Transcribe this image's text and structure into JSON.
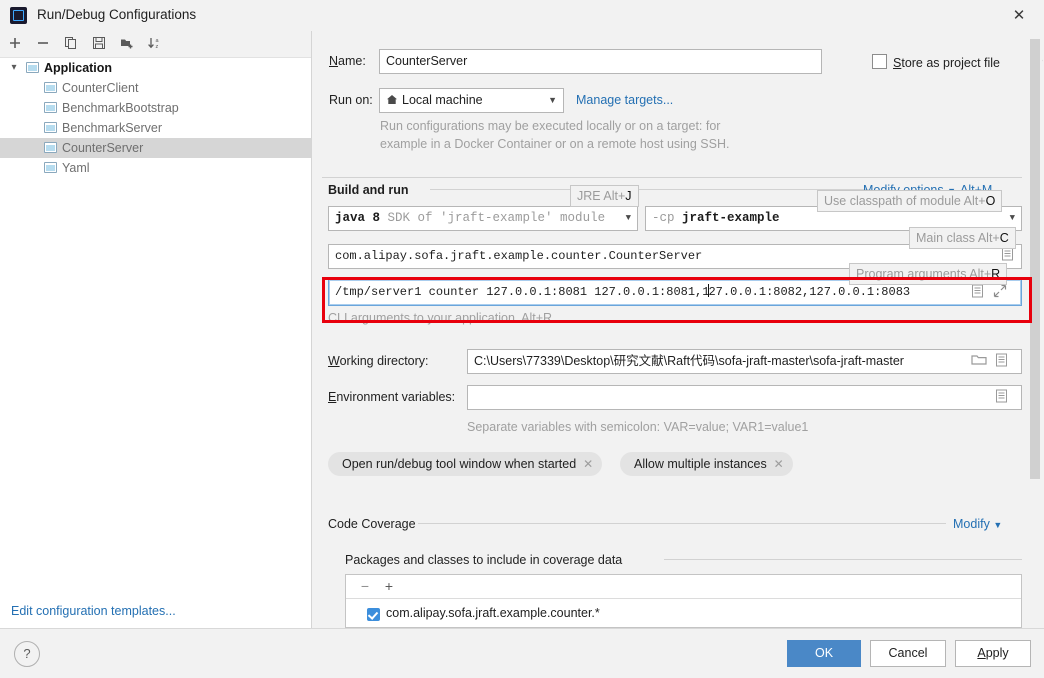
{
  "window": {
    "title": "Run/Debug Configurations",
    "close_label": "✕",
    "bleed_text": "···········  ·········  ············"
  },
  "sidebar": {
    "toolbar": [
      {
        "name": "add-icon",
        "glyph": "+"
      },
      {
        "name": "remove-icon",
        "glyph": "−"
      },
      {
        "name": "copy-icon",
        "glyph": "copy"
      },
      {
        "name": "save-icon",
        "glyph": "save"
      },
      {
        "name": "new-folder-icon",
        "glyph": "folder"
      },
      {
        "name": "sort-icon",
        "glyph": "sort-az"
      }
    ],
    "root": {
      "label": "Application",
      "expanded": true
    },
    "items": [
      {
        "label": "CounterClient",
        "selected": false
      },
      {
        "label": "BenchmarkBootstrap",
        "selected": false
      },
      {
        "label": "BenchmarkServer",
        "selected": false
      },
      {
        "label": "CounterServer",
        "selected": true
      },
      {
        "label": "Yaml",
        "selected": false
      }
    ],
    "edit_templates_link": "Edit configuration templates..."
  },
  "form": {
    "name_label": "Name:",
    "name_label_mnemonic": "N",
    "name_value": "CounterServer",
    "store_as_project_file": "Store as project file",
    "store_as_project_file_mnemonic": "S",
    "store_checked": false,
    "run_on_label": "Run on:",
    "run_on_value": "Local machine",
    "manage_targets_link": "Manage targets...",
    "run_on_hint_line1": "Run configurations may be executed locally or on a target: for",
    "run_on_hint_line2": "example in a Docker Container or on a remote host using SSH."
  },
  "build_and_run": {
    "section_title": "Build and run",
    "modify_options_link": "Modify options",
    "modify_options_shortcut": "Alt+M",
    "jre_value_bold": "java 8",
    "jre_value_gray": "SDK of 'jraft-example' module",
    "classpath_prefix": "-cp",
    "classpath_value": "jraft-example",
    "main_class_value": "com.alipay.sofa.jraft.example.counter.CounterServer",
    "program_arguments_before_caret": "/tmp/server1 counter 127.0.0.1:8081 127.0.0.1:8081,1",
    "program_arguments_after_caret": "27.0.0.1:8082,127.0.0.1:8083",
    "program_arguments_hint": "CLI arguments to your application. Alt+R",
    "tooltips": [
      {
        "text": "JRE Alt+",
        "mnemonic": "J"
      },
      {
        "text": "Use classpath of module Alt+",
        "mnemonic": "O"
      },
      {
        "text": "Main class Alt+",
        "mnemonic": "C"
      },
      {
        "text": "Program arguments Alt+",
        "mnemonic": "R"
      }
    ]
  },
  "paths": {
    "working_directory_label": "Working directory:",
    "working_directory_mnemonic": "W",
    "working_directory_value": "C:\\Users\\77339\\Desktop\\研究文献\\Raft代码\\sofa-jraft-master\\sofa-jraft-master",
    "environment_variables_label": "Environment variables:",
    "environment_variables_mnemonic": "E",
    "environment_variables_value": "",
    "environment_hint": "Separate variables with semicolon: VAR=value; VAR1=value1"
  },
  "option_chips": [
    {
      "label": "Open run/debug tool window when started",
      "close": "✕"
    },
    {
      "label": "Allow multiple instances",
      "close": "✕",
      "mnemonic_index": 10
    }
  ],
  "code_coverage": {
    "section_title": "Code Coverage",
    "modify_link": "Modify",
    "packages_title": "Packages and classes to include in coverage data",
    "toolbar": [
      {
        "name": "remove-icon",
        "glyph": "−"
      },
      {
        "name": "add-icon",
        "glyph": "+"
      }
    ],
    "rows": [
      {
        "label": "com.alipay.sofa.jraft.example.counter.*",
        "checked": true
      }
    ]
  },
  "footer": {
    "help_label": "?",
    "ok_label": "OK",
    "cancel_label": "Cancel",
    "apply_label": "Apply",
    "apply_mnemonic": "A"
  },
  "colors": {
    "accent": "#2470b3",
    "primary_button": "#4a88c7",
    "annotation": "#e8000d",
    "selection": "#d6d6d6"
  }
}
